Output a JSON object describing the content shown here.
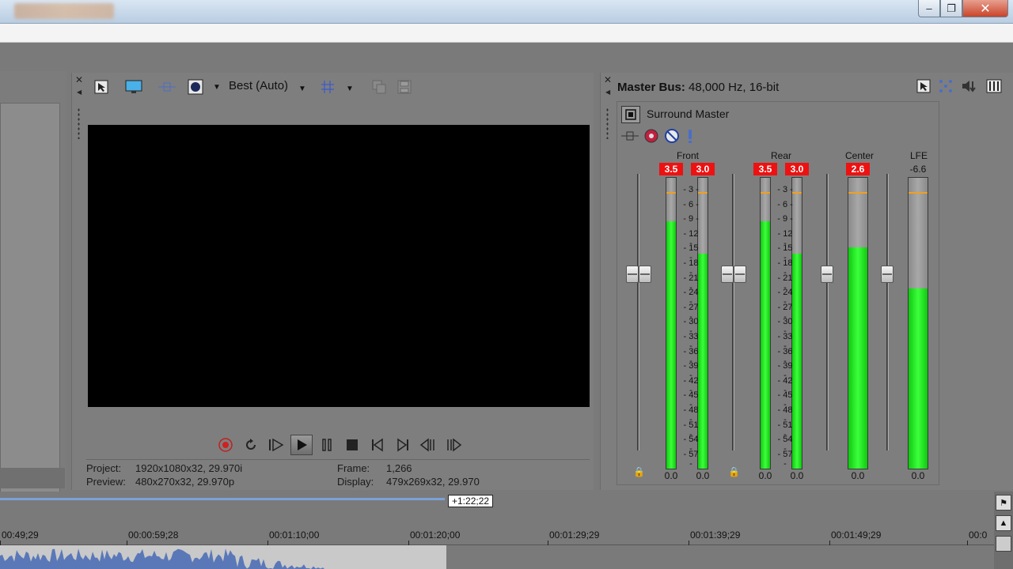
{
  "window": {
    "controls": {
      "minimize": "–",
      "maximize": "❐",
      "close": "✕"
    }
  },
  "preview": {
    "quality": "Best (Auto)",
    "info": {
      "project_label": "Project:",
      "project_value": "1920x1080x32, 29.970i",
      "preview_label": "Preview:",
      "preview_value": "480x270x32, 29.970p",
      "frame_label": "Frame:",
      "frame_value": "1,266",
      "display_label": "Display:",
      "display_value": "479x269x32, 29.970"
    }
  },
  "master_bus": {
    "title_bold": "Master Bus:",
    "title_rest": " 48,000 Hz, 16-bit",
    "surround_label": "Surround Master",
    "channels": {
      "front": "Front",
      "rear": "Rear",
      "center": "Center",
      "lfe": "LFE"
    },
    "peaks": {
      "front_l": "3.5",
      "front_r": "3.0",
      "rear_l": "3.5",
      "rear_r": "3.0",
      "center": "2.6",
      "lfe": "-6.6"
    },
    "bottom_values": {
      "front_l": "0.0",
      "front_r": "0.0",
      "rear_l": "0.0",
      "rear_r": "0.0",
      "center": "0.0",
      "lfe": "0.0"
    },
    "scale": [
      "3",
      "6",
      "9",
      "12",
      "15",
      "18",
      "21",
      "24",
      "27",
      "30",
      "33",
      "36",
      "39",
      "42",
      "45",
      "48",
      "51",
      "54",
      "57"
    ],
    "levels": {
      "front_l": 0.85,
      "front_r": 0.74,
      "rear_l": 0.85,
      "rear_r": 0.74,
      "center": 0.76,
      "lfe": 0.62
    }
  },
  "timeline": {
    "marker": "+1:22;22",
    "ticks": [
      "00:49;29",
      "00:00:59;28",
      "00:01:10;00",
      "00:01:20;00",
      "00:01:29;29",
      "00:01:39;29",
      "00:01:49;29",
      "00:0"
    ]
  }
}
